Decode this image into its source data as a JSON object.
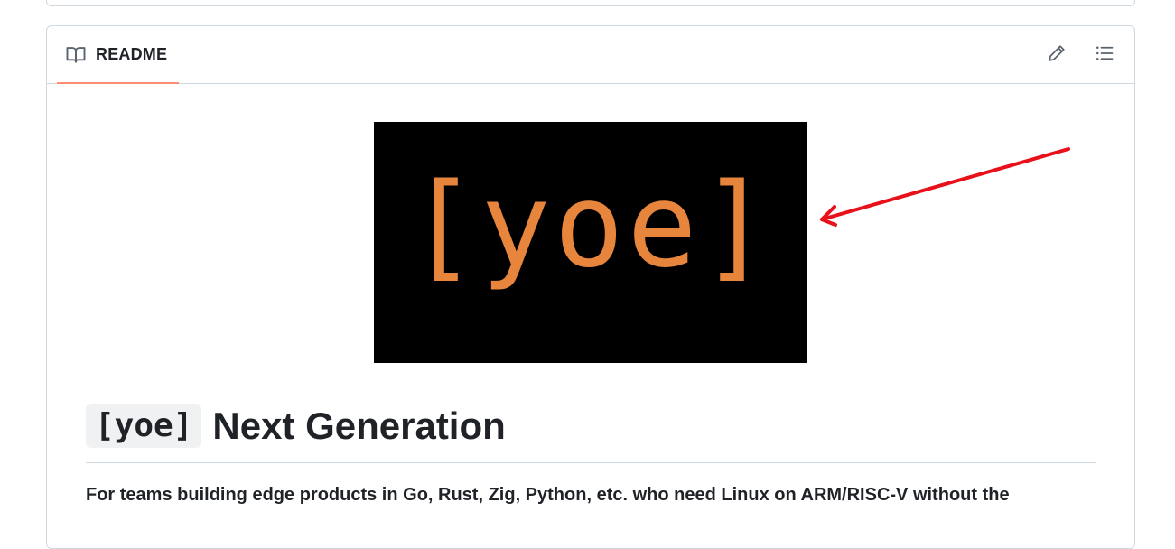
{
  "readme": {
    "tab_label": "README",
    "logo_text": "[yoe]",
    "heading_code": "[yoe]",
    "heading_text": "Next Generation",
    "paragraph": "For teams building edge products in Go, Rust, Zig, Python, etc. who need Linux on ARM/RISC-V without the"
  },
  "icons": {
    "tab": "book-icon",
    "edit": "pencil-icon",
    "outline": "list-icon"
  },
  "colors": {
    "tab_underline": "#fd8c73",
    "logo_bg": "#000000",
    "logo_fg": "#e8853d",
    "annotation_arrow": "#e8101a"
  }
}
